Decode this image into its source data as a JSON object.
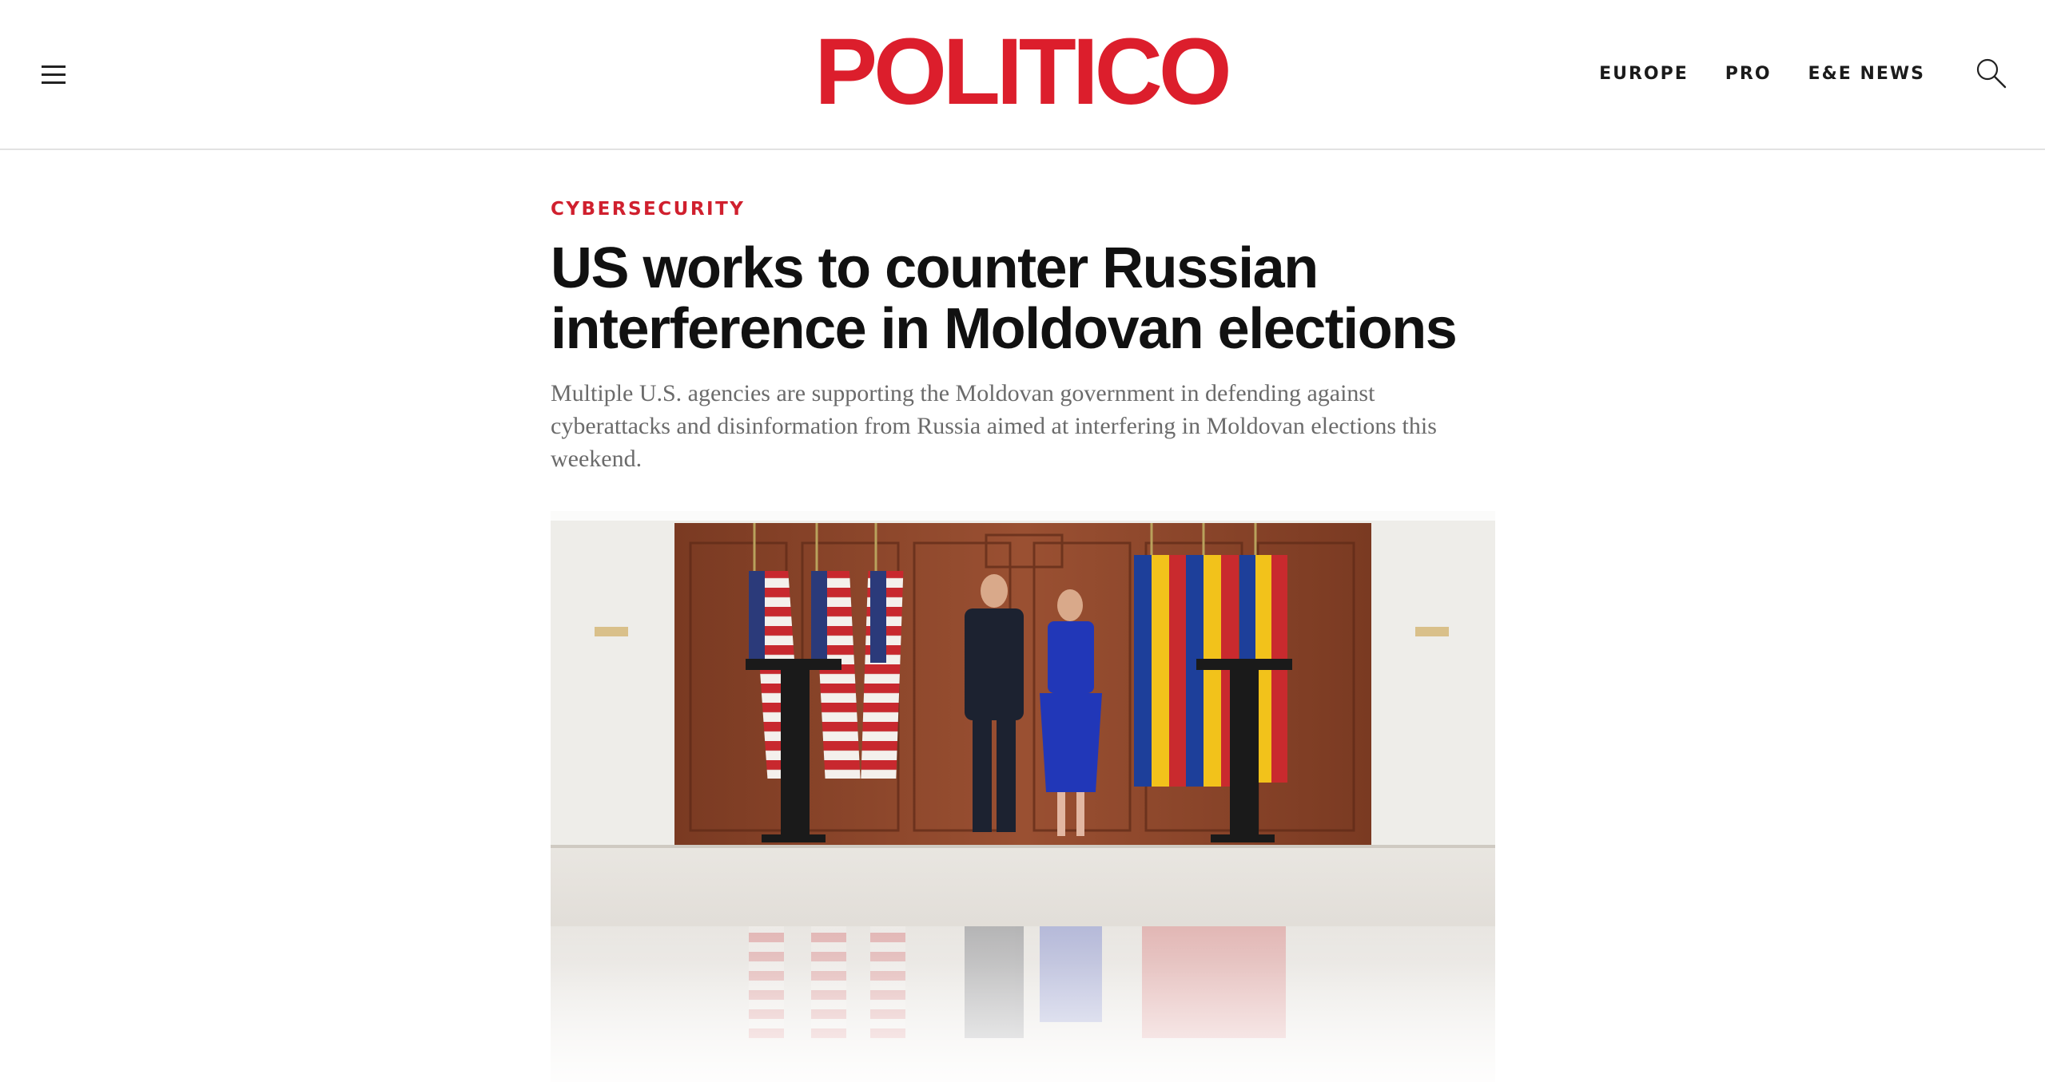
{
  "header": {
    "logo_text": "POLITICO",
    "nav": [
      {
        "label": "EUROPE"
      },
      {
        "label": "PRO"
      },
      {
        "label": "E&E NEWS"
      }
    ],
    "icons": {
      "menu": "hamburger-menu-icon",
      "search": "search-icon"
    }
  },
  "article": {
    "kicker": "CYBERSECURITY",
    "headline": "US works to counter Russian interference in Moldovan elections",
    "dek": "Multiple U.S. agencies are supporting the Moldovan government in defending against cyberattacks and disinformation from Russia aimed at interfering in Moldovan elections this weekend."
  },
  "colors": {
    "brand_red": "#dc1e2c",
    "kicker_red": "#d0202e",
    "headline": "#111111",
    "dek": "#6b6b6b"
  }
}
